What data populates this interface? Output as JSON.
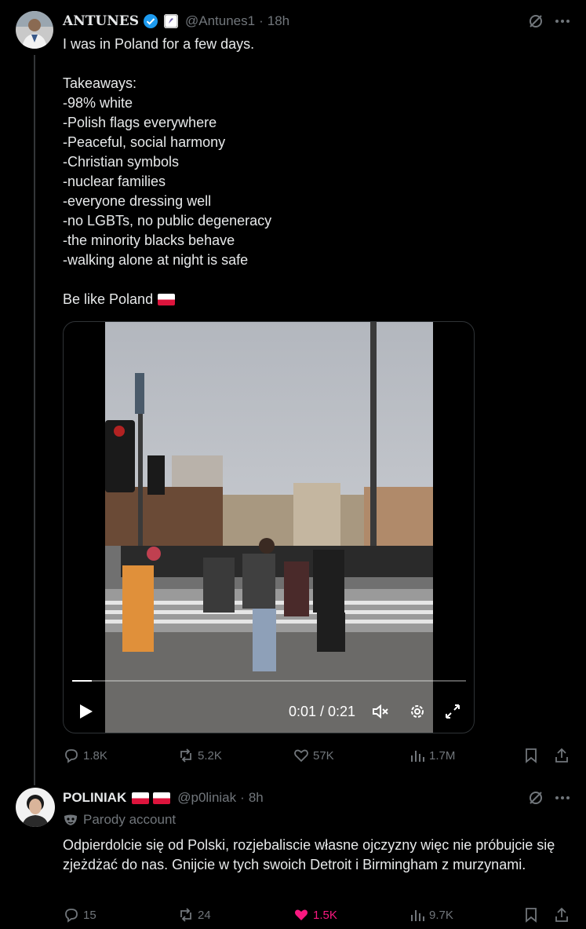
{
  "tweet1": {
    "display_name": "ANTUNES",
    "handle": "@Antunes1",
    "separator": "·",
    "time": "18h",
    "text": "I was in Poland for a few days.\n\nTakeaways:\n-98% white\n-Polish flags everywhere\n-Peaceful, social harmony\n-Christian symbols\n-nuclear families\n-everyone dressing well\n-no LGBTs, no public degeneracy\n-the minority blacks behave\n-walking alone at night is safe",
    "closing_line": "Be like Poland",
    "video": {
      "time_display": "0:01 / 0:21",
      "progress": 0.05
    },
    "stats": {
      "replies": "1.8K",
      "reposts": "5.2K",
      "likes": "57K",
      "views": "1.7M"
    }
  },
  "tweet2": {
    "display_name": "POLINIAK",
    "handle": "@p0liniak",
    "separator": "·",
    "time": "8h",
    "parody_label": "Parody account",
    "text": "Odpierdolcie się od Polski, rozjebaliscie własne ojczyzny więc nie próbujcie się zjeżdżać do nas. Gnijcie w tych swoich Detroit i Birmingham z murzynami.",
    "stats": {
      "replies": "15",
      "reposts": "24",
      "likes": "1.5K",
      "views": "9.7K"
    },
    "liked": true
  },
  "colors": {
    "background": "#000000",
    "text": "#e7e9ea",
    "muted": "#71767b",
    "verified": "#1d9bf0",
    "like_active": "#f91880"
  }
}
